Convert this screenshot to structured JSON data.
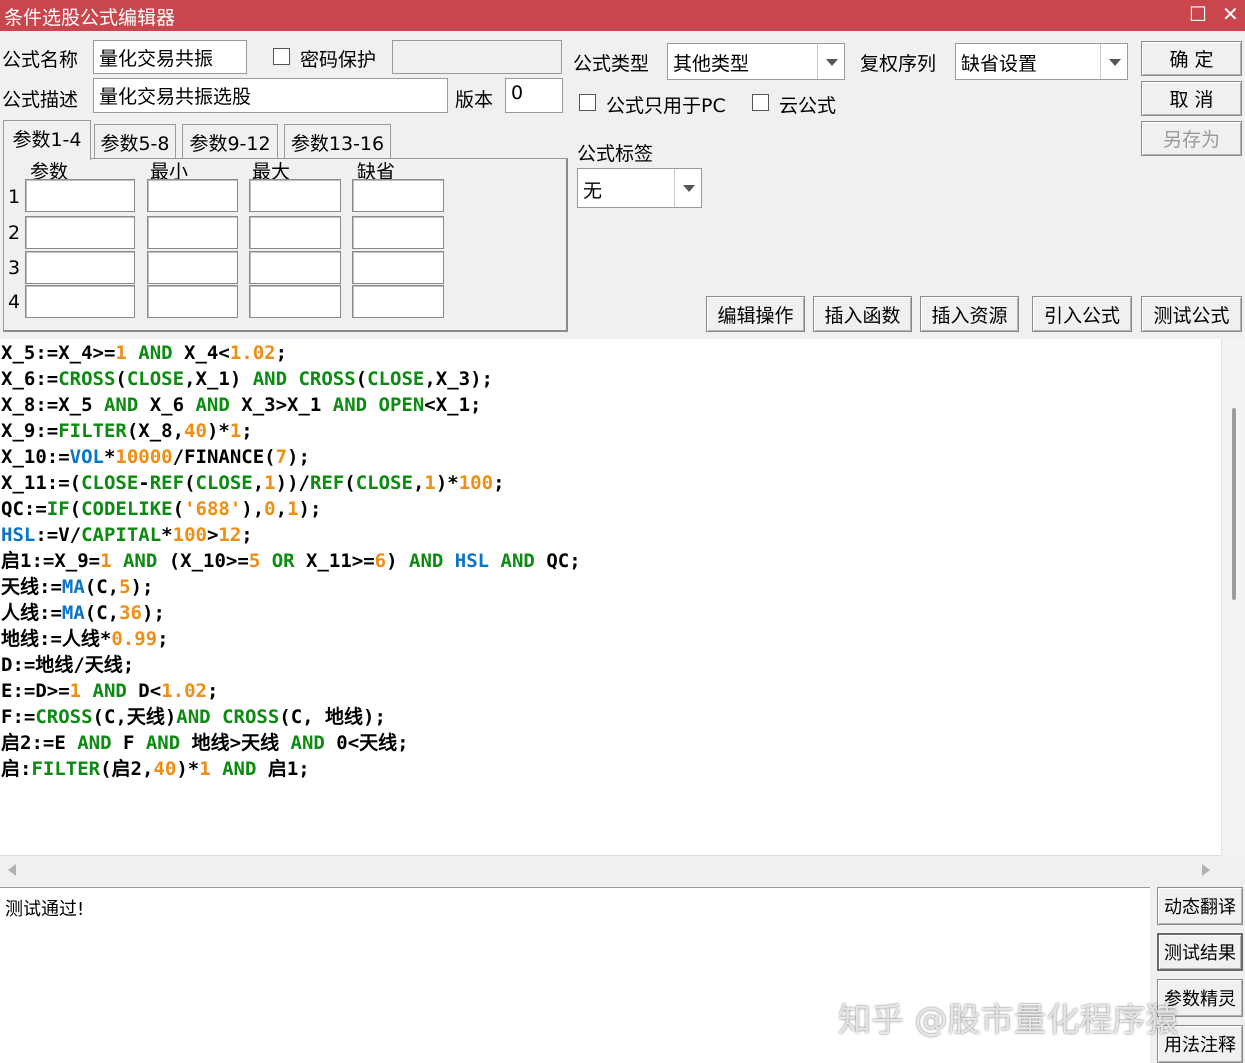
{
  "window": {
    "title": "条件选股公式编辑器",
    "maximize_glyph": "☐",
    "close_glyph": "✕"
  },
  "formula": {
    "name_label": "公式名称",
    "name_value": "量化交易共振",
    "password_label": "密码保护",
    "password_checked": false,
    "password_value": "",
    "desc_label": "公式描述",
    "desc_value": "量化交易共振选股",
    "version_label": "版本",
    "version_value": "0",
    "type_label": "公式类型",
    "type_value": "其他类型",
    "rights_label": "复权序列",
    "rights_value": "缺省设置",
    "pc_only_label": "公式只用于PC",
    "pc_only_checked": false,
    "cloud_label": "云公式",
    "cloud_checked": false,
    "tag_label": "公式标签",
    "tag_value": "无"
  },
  "dialog_buttons": {
    "ok": "确  定",
    "cancel": "取  消",
    "save_as": "另存为"
  },
  "param_tabs": [
    "参数1-4",
    "参数5-8",
    "参数9-12",
    "参数13-16"
  ],
  "param_table": {
    "headers": [
      "参数",
      "最小",
      "最大",
      "缺省"
    ],
    "rows": [
      "1",
      "2",
      "3",
      "4"
    ]
  },
  "toolbar": {
    "edit_ops": "编辑操作",
    "insert_func": "插入函数",
    "insert_resource": "插入资源",
    "import_formula": "引入公式",
    "test_formula": "测试公式"
  },
  "code_lines": [
    [
      [
        "X_5:=X_4>=",
        ""
      ],
      [
        "1",
        "o"
      ],
      [
        " AND ",
        "g"
      ],
      [
        "X_4<",
        ""
      ],
      [
        "1.02",
        "o"
      ],
      [
        ";",
        ""
      ]
    ],
    [
      [
        "X_6:=",
        ""
      ],
      [
        "CROSS",
        "g"
      ],
      [
        "(",
        ""
      ],
      [
        "CLOSE",
        "g"
      ],
      [
        ",X_1) ",
        ""
      ],
      [
        "AND ",
        "g"
      ],
      [
        "CROSS",
        "g"
      ],
      [
        "(",
        ""
      ],
      [
        "CLOSE",
        "g"
      ],
      [
        ",X_3);",
        ""
      ]
    ],
    [
      [
        "X_8:=X_5 ",
        ""
      ],
      [
        "AND ",
        "g"
      ],
      [
        "X_6 ",
        ""
      ],
      [
        "AND ",
        "g"
      ],
      [
        "X_3>X_1 ",
        ""
      ],
      [
        "AND ",
        "g"
      ],
      [
        "OPEN",
        "g"
      ],
      [
        "<X_1;",
        ""
      ]
    ],
    [
      [
        "X_9:=",
        ""
      ],
      [
        "FILTER",
        "g"
      ],
      [
        "(X_8,",
        ""
      ],
      [
        "40",
        "o"
      ],
      [
        ")*",
        ""
      ],
      [
        "1",
        "o"
      ],
      [
        ";",
        ""
      ]
    ],
    [
      [
        "X_10:=",
        ""
      ],
      [
        "VOL",
        "b"
      ],
      [
        "*",
        ""
      ],
      [
        "10000",
        "o"
      ],
      [
        "/FINANCE(",
        ""
      ],
      [
        "7",
        "o"
      ],
      [
        ");",
        ""
      ]
    ],
    [
      [
        "X_11:=(",
        ""
      ],
      [
        "CLOSE",
        "g"
      ],
      [
        "-",
        ""
      ],
      [
        "REF",
        "g"
      ],
      [
        "(",
        ""
      ],
      [
        "CLOSE",
        "g"
      ],
      [
        ",",
        ""
      ],
      [
        "1",
        "o"
      ],
      [
        "))/",
        ""
      ],
      [
        "REF",
        "g"
      ],
      [
        "(",
        ""
      ],
      [
        "CLOSE",
        "g"
      ],
      [
        ",",
        ""
      ],
      [
        "1",
        "o"
      ],
      [
        ")*",
        ""
      ],
      [
        "100",
        "o"
      ],
      [
        ";",
        ""
      ]
    ],
    [
      [
        "QC:=",
        ""
      ],
      [
        "IF",
        "g"
      ],
      [
        "(",
        ""
      ],
      [
        "CODELIKE",
        "g"
      ],
      [
        "(",
        ""
      ],
      [
        "'688'",
        "o"
      ],
      [
        "),",
        ""
      ],
      [
        "0",
        "o"
      ],
      [
        ",",
        ""
      ],
      [
        "1",
        "o"
      ],
      [
        ");",
        ""
      ]
    ],
    [
      [
        "HSL",
        "b"
      ],
      [
        ":=V/",
        ""
      ],
      [
        "CAPITAL",
        "g"
      ],
      [
        "*",
        ""
      ],
      [
        "100",
        "o"
      ],
      [
        ">",
        ""
      ],
      [
        "12",
        "o"
      ],
      [
        ";",
        ""
      ]
    ],
    [
      [
        "启1:=X_9=",
        ""
      ],
      [
        "1",
        "o"
      ],
      [
        " AND ",
        "g"
      ],
      [
        "(X_10>=",
        ""
      ],
      [
        "5",
        "o"
      ],
      [
        " OR ",
        "g"
      ],
      [
        "X_11>=",
        ""
      ],
      [
        "6",
        "o"
      ],
      [
        ") ",
        ""
      ],
      [
        "AND ",
        "g"
      ],
      [
        "HSL",
        "b"
      ],
      [
        " AND ",
        "g"
      ],
      [
        "QC;",
        ""
      ]
    ],
    [
      [
        "天线:=",
        ""
      ],
      [
        "MA",
        "b"
      ],
      [
        "(C,",
        ""
      ],
      [
        "5",
        "o"
      ],
      [
        ");",
        ""
      ]
    ],
    [
      [
        "人线:=",
        ""
      ],
      [
        "MA",
        "b"
      ],
      [
        "(C,",
        ""
      ],
      [
        "36",
        "o"
      ],
      [
        ");",
        ""
      ]
    ],
    [
      [
        "地线:=人线*",
        ""
      ],
      [
        "0.99",
        "o"
      ],
      [
        ";",
        ""
      ]
    ],
    [
      [
        "D:=地线/天线;",
        ""
      ]
    ],
    [
      [
        "E:=D>=",
        ""
      ],
      [
        "1",
        "o"
      ],
      [
        " AND ",
        "g"
      ],
      [
        "D<",
        ""
      ],
      [
        "1.02",
        "o"
      ],
      [
        ";",
        ""
      ]
    ],
    [
      [
        "F:=",
        ""
      ],
      [
        "CROSS",
        "g"
      ],
      [
        "(C,天线)",
        ""
      ],
      [
        "AND ",
        "g"
      ],
      [
        "CROSS",
        "g"
      ],
      [
        "(C, 地线);",
        ""
      ]
    ],
    [
      [
        "启2:=E ",
        ""
      ],
      [
        "AND ",
        "g"
      ],
      [
        "F ",
        ""
      ],
      [
        "AND ",
        "g"
      ],
      [
        "地线>天线 ",
        ""
      ],
      [
        "AND ",
        "g"
      ],
      [
        "0<天线;",
        ""
      ]
    ],
    [
      [
        "启:",
        ""
      ],
      [
        "FILTER",
        "g"
      ],
      [
        "(启2,",
        ""
      ],
      [
        "40",
        "o"
      ],
      [
        ")*",
        ""
      ],
      [
        "1",
        "o"
      ],
      [
        " AND ",
        "g"
      ],
      [
        "启1;",
        ""
      ]
    ]
  ],
  "result": {
    "text": "测试通过!"
  },
  "side_buttons": {
    "dynamic_translate": "动态翻译",
    "test_result": "测试结果",
    "param_wizard": "参数精灵",
    "usage_notes": "用法注释"
  },
  "watermark": "知乎 @股市量化程序猿",
  "colors": {
    "titlebar": "#c8464c",
    "keyword_green": "#0d8a12",
    "number_orange": "#ee8e12",
    "builtin_blue": "#0a74c8"
  }
}
